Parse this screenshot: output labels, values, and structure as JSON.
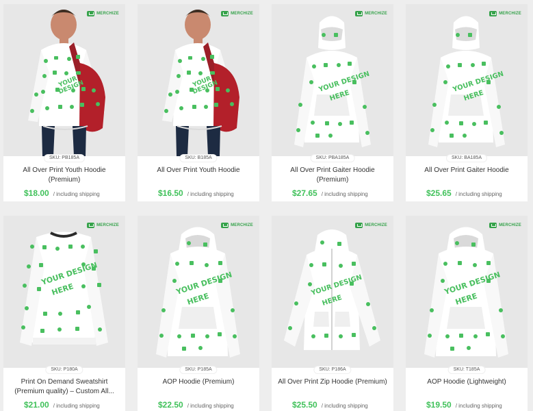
{
  "brand": {
    "name": "MERCHIZE",
    "color": "#35a24a",
    "price_color": "#40c15a"
  },
  "products": [
    {
      "sku": "SKU: PB185A",
      "title": "All Over Print Youth Hoodie (Premium)",
      "price": "$18.00",
      "shipping": "/ including shipping",
      "image": "youth-model"
    },
    {
      "sku": "SKU: B185A",
      "title": "All Over Print Youth Hoodie",
      "price": "$16.50",
      "shipping": "/ including shipping",
      "image": "youth-model"
    },
    {
      "sku": "SKU: PBA185A",
      "title": "All Over Print Gaiter Hoodie (Premium)",
      "price": "$27.65",
      "shipping": "/ including shipping",
      "image": "gaiter-hoodie"
    },
    {
      "sku": "SKU: BA185A",
      "title": "All Over Print Gaiter Hoodie",
      "price": "$25.65",
      "shipping": "/ including shipping",
      "image": "gaiter-hoodie"
    },
    {
      "sku": "SKU: P180A",
      "title": "Print On Demand Sweatshirt (Premium quality) – Custom All...",
      "price": "$21.00",
      "shipping": "/ including shipping",
      "image": "sweatshirt"
    },
    {
      "sku": "SKU: P185A",
      "title": "AOP Hoodie (Premium)",
      "price": "$22.50",
      "shipping": "/ including shipping",
      "image": "hoodie"
    },
    {
      "sku": "SKU: P186A",
      "title": "All Over Print Zip Hoodie (Premium)",
      "price": "$25.50",
      "shipping": "/ including shipping",
      "image": "zip-hoodie"
    },
    {
      "sku": "SKU: T185A",
      "title": "AOP Hoodie (Lightweight)",
      "price": "$19.50",
      "shipping": "/ including shipping",
      "image": "hoodie"
    }
  ],
  "design_text": [
    "YOUR DESIGN",
    "HERE"
  ]
}
